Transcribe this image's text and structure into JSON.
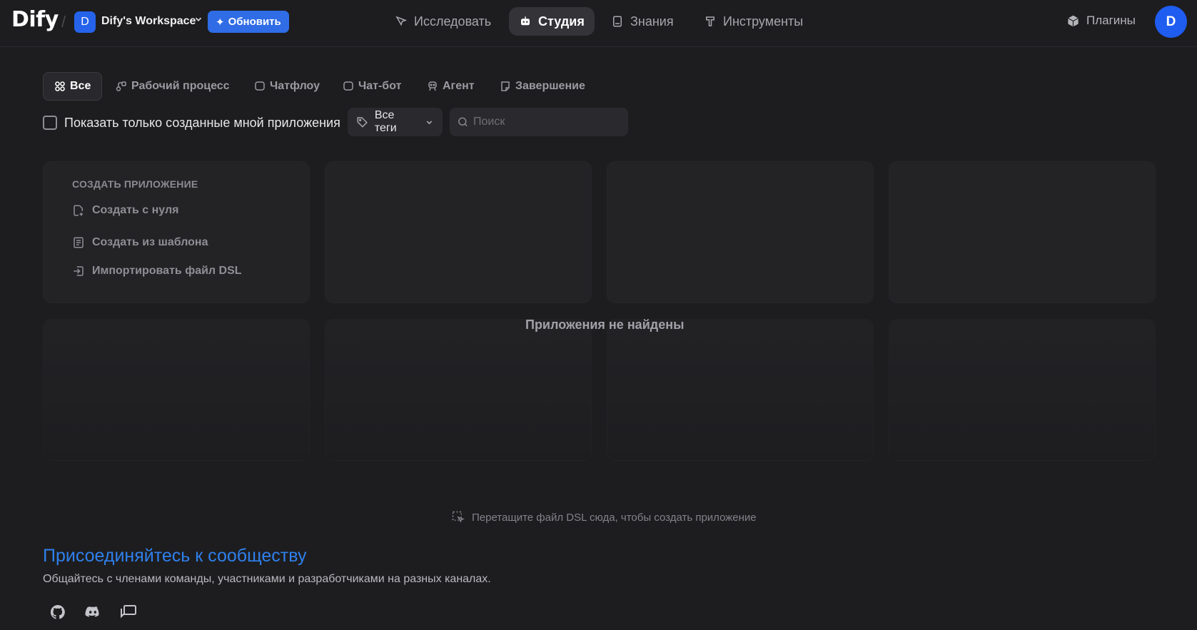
{
  "header": {
    "logo": "Dify",
    "workspace_initial": "D",
    "workspace_name": "Dify's Workspace",
    "upgrade_label": "Обновить",
    "nav": [
      {
        "label": "Исследовать",
        "icon": "compass-icon"
      },
      {
        "label": "Студия",
        "icon": "robot-icon",
        "active": true
      },
      {
        "label": "Знания",
        "icon": "book-icon"
      },
      {
        "label": "Инструменты",
        "icon": "hammer-icon"
      }
    ],
    "plugins_label": "Плагины",
    "avatar_initial": "D"
  },
  "tabs": [
    {
      "label": "Все",
      "icon": "grid-icon",
      "active": true
    },
    {
      "label": "Рабочий процесс",
      "icon": "workflow-icon"
    },
    {
      "label": "Чатфлоу",
      "icon": "chatflow-icon"
    },
    {
      "label": "Чат-бот",
      "icon": "chatbot-icon"
    },
    {
      "label": "Агент",
      "icon": "agent-icon"
    },
    {
      "label": "Завершение",
      "icon": "completion-icon"
    }
  ],
  "filters": {
    "only_mine_label": "Показать только созданные мной приложения",
    "only_mine_checked": false,
    "tags_label": "Все теги",
    "search_placeholder": "Поиск",
    "search_value": ""
  },
  "create_card": {
    "title": "СОЗДАТЬ ПРИЛОЖЕНИЕ",
    "items": [
      {
        "label": "Создать с нуля",
        "icon": "file-plus-icon"
      },
      {
        "label": "Создать из шаблона",
        "icon": "template-icon"
      },
      {
        "label": "Импортировать файл DSL",
        "icon": "import-icon"
      }
    ]
  },
  "empty_state": "Приложения не найдены",
  "drop_hint": "Перетащите файл DSL сюда, чтобы создать приложение",
  "community": {
    "title": "Присоединяйтесь к сообществу",
    "subtitle": "Общайтесь с членами команды, участниками и разработчиками на разных каналах.",
    "links": [
      "github-icon",
      "discord-icon",
      "forum-icon"
    ]
  },
  "colors": {
    "background": "#1d1d1f",
    "accent": "#2f6ce5",
    "link": "#2f80ed",
    "avatar": "#1f5cf0"
  }
}
